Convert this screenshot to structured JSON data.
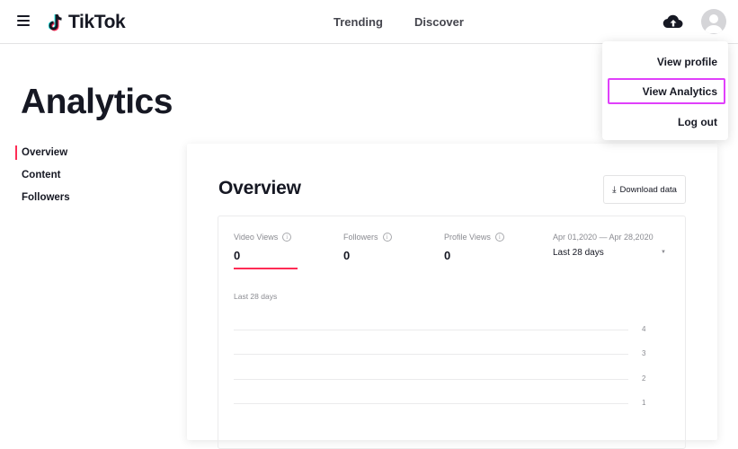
{
  "header": {
    "brand": "TikTok",
    "nav": {
      "trending": "Trending",
      "discover": "Discover"
    }
  },
  "page": {
    "title": "Analytics"
  },
  "sidenav": {
    "items": [
      {
        "label": "Overview",
        "active": true
      },
      {
        "label": "Content",
        "active": false
      },
      {
        "label": "Followers",
        "active": false
      }
    ]
  },
  "overview": {
    "title": "Overview",
    "download_label": "Download data",
    "metrics": [
      {
        "label": "Video Views",
        "value": "0",
        "selected": true
      },
      {
        "label": "Followers",
        "value": "0",
        "selected": false
      },
      {
        "label": "Profile Views",
        "value": "0",
        "selected": false
      }
    ],
    "date_range": "Apr 01,2020 — Apr 28,2020",
    "period_select": "Last 28 days",
    "chart_caption": "Last 28 days",
    "y_ticks": [
      "4",
      "3",
      "2",
      "1"
    ]
  },
  "dropdown": {
    "items": [
      "View profile",
      "View Analytics",
      "Log out"
    ],
    "highlighted": "View Analytics"
  },
  "colors": {
    "accent": "#fe2c55",
    "highlight": "#e040fb",
    "text": "#161823",
    "muted": "#8a8b91"
  }
}
